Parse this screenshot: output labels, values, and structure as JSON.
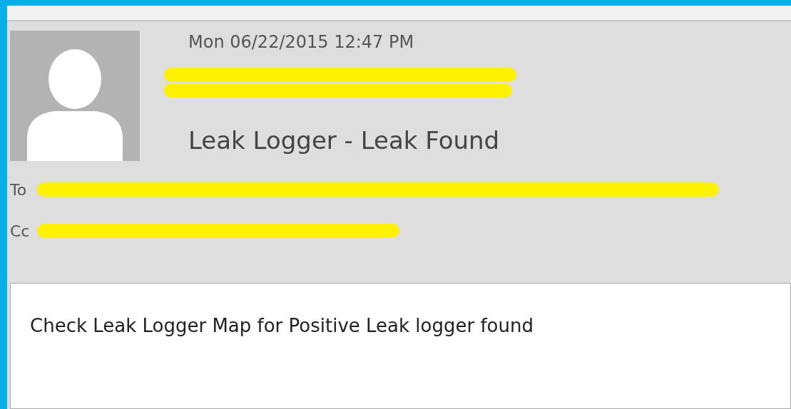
{
  "message": {
    "date": "Mon 06/22/2015 12:47 PM",
    "sender": {
      "redacted": true
    },
    "subject": "Leak Logger - Leak Found"
  },
  "recipients": [
    {
      "label": "To",
      "redacted": true
    },
    {
      "label": "Cc",
      "redacted": true
    }
  ],
  "body": {
    "text": "Check Leak Logger Map for Positive Leak logger found"
  }
}
